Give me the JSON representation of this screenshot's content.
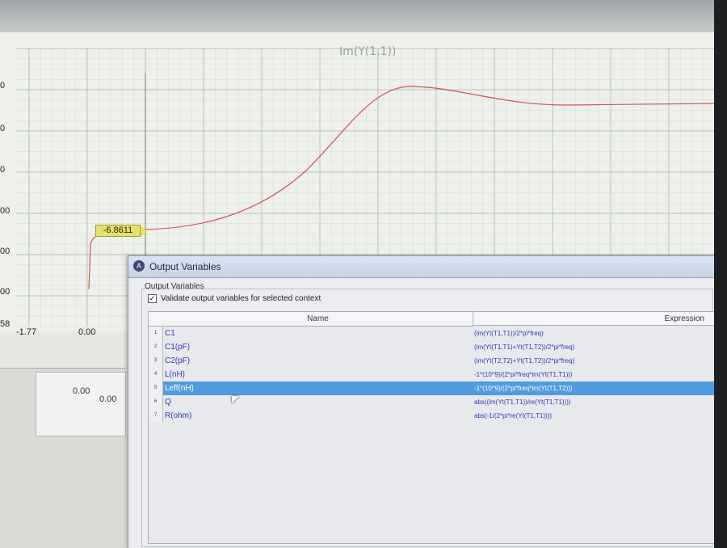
{
  "plot": {
    "title": "Im(Y(1,1))",
    "y_ticks": [
      "0",
      "0",
      "0",
      "00",
      "00",
      "00",
      "58"
    ],
    "x_ticks": [
      "-1.77",
      "0.00"
    ],
    "marker_value": "-6.8611",
    "curve_color": "#d9534f",
    "grid_color": "#b8c2b4"
  },
  "mini_plot": {
    "value_left": "0.00",
    "value_axis": "0.00"
  },
  "dialog": {
    "title": "Output Variables",
    "group_label": "Output Variables",
    "validate_checkbox": {
      "label": "Validate output variables for selected context",
      "checked": true
    },
    "columns": {
      "name": "Name",
      "expression": "Expression"
    },
    "selected_row": 5,
    "rows": [
      {
        "num": "1",
        "name": "C1",
        "expression": "(im(Yt(T1,T1))/2*pi*freq)"
      },
      {
        "num": "2",
        "name": "C1(pF)",
        "expression": "(im(Yt(T1,T1)+Yt(T1,T2))/2*pi*freq)"
      },
      {
        "num": "3",
        "name": "C2(pF)",
        "expression": "(im(Yt(T2,T2)+Yt(T1,T2))/2*pi*freq)"
      },
      {
        "num": "4",
        "name": "L(nH)",
        "expression": "-1*(10^9)/(2*pi*freq*im(Yt(T1,T1)))"
      },
      {
        "num": "5",
        "name": "Leff(nH)",
        "expression": "-1*(10^9)/(2*pi*freq*im(Yt(T1,T2)))"
      },
      {
        "num": "6",
        "name": "Q",
        "expression": "abs((im(Yt(T1,T1))/re(Yt(T1,T1))))"
      },
      {
        "num": "7",
        "name": "R(ohm)",
        "expression": "abs(-1/(2*pi*re(Yt(T1,T1))))"
      }
    ]
  }
}
